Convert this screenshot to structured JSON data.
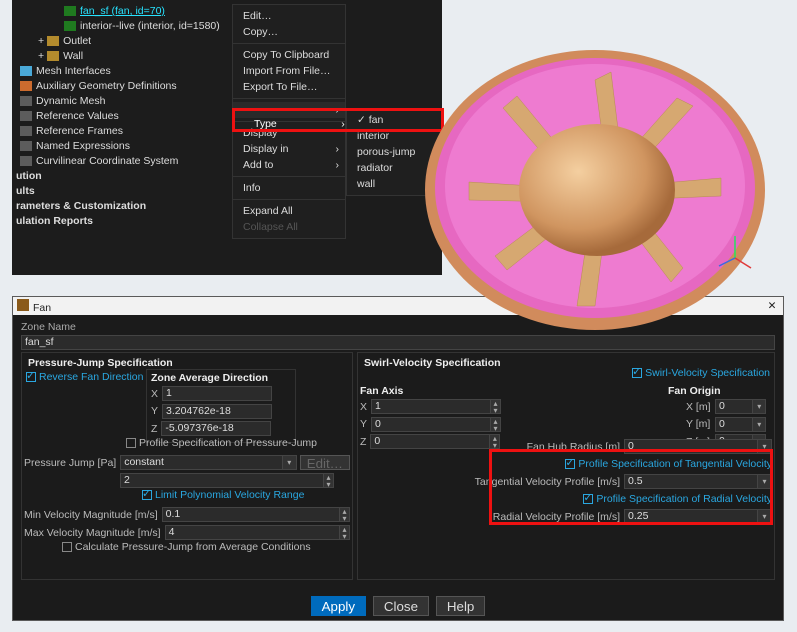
{
  "tree": {
    "fan_sf": "fan_sf (fan, id=70)",
    "interior": "interior--live (interior, id=1580)",
    "outlet": "Outlet",
    "wall": "Wall",
    "mesh_interfaces": "Mesh Interfaces",
    "aux_geom": "Auxiliary Geometry Definitions",
    "dynamic_mesh": "Dynamic Mesh",
    "ref_values": "Reference Values",
    "ref_frames": "Reference Frames",
    "named_expr": "Named Expressions",
    "curv_coord": "Curvilinear Coordinate System",
    "ution": "ution",
    "ults": "ults",
    "rameters": "rameters & Customization",
    "ulation_reports": "ulation Reports"
  },
  "ctx": {
    "edit": "Edit…",
    "copy": "Copy…",
    "copytcb": "Copy To Clipboard",
    "import": "Import From File…",
    "export": "Export To File…",
    "type": "Type",
    "display": "Display",
    "displayin": "Display in",
    "addto": "Add to",
    "info": "Info",
    "expand": "Expand All",
    "collapse": "Collapse All"
  },
  "typesub": {
    "fan": "fan",
    "interior": "interior",
    "porous": "porous-jump",
    "radiator": "radiator",
    "wall": "wall"
  },
  "dialog": {
    "title": "Fan",
    "close_x": "✕",
    "zone_name_label": "Zone Name",
    "zone_name_value": "fan_sf",
    "pj_spec": "Pressure-Jump Specification",
    "sv_spec": "Swirl-Velocity Specification",
    "reverse_fan": "Reverse Fan Direction",
    "zone_avg_dir": "Zone Average Direction",
    "x_label": "X",
    "y_label": "Y",
    "z_label": "Z",
    "zad_x": "1",
    "zad_y": "3.204762e-18",
    "zad_z": "-5.097376e-18",
    "profile_pj": "Profile Specification of Pressure-Jump",
    "pj_label": "Pressure Jump [Pa]",
    "pj_method": "constant",
    "pj_value": "2",
    "edit_btn": "Edit…",
    "limit_poly": "Limit Polynomial Velocity Range",
    "min_vm_label": "Min Velocity Magnitude [m/s]",
    "min_vm": "0.1",
    "max_vm_label": "Max Velocity Magnitude [m/s]",
    "max_vm": "4",
    "calc_pj_avg": "Calculate Pressure-Jump from Average Conditions",
    "sv_spec_chk": "Swirl-Velocity Specification",
    "fan_axis": "Fan Axis",
    "fa_x": "1",
    "fa_y": "0",
    "fa_z": "0",
    "fan_origin": "Fan Origin",
    "fo_x_label": "X [m]",
    "fo_y_label": "Y [m]",
    "fo_z_label": "Z [m]",
    "fo_x": "0",
    "fo_y": "0",
    "fo_z": "0",
    "hub_r_label": "Fan Hub Radius [m]",
    "hub_r": "0",
    "prof_tang": "Profile Specification of Tangential Velocity",
    "tang_prof_label": "Tangential Velocity Profile [m/s]",
    "tang_prof": "0.5",
    "prof_rad": "Profile Specification of Radial Velocity",
    "rad_prof_label": "Radial Velocity Profile [m/s]",
    "rad_prof": "0.25",
    "apply": "Apply",
    "close_btn": "Close",
    "help": "Help"
  }
}
